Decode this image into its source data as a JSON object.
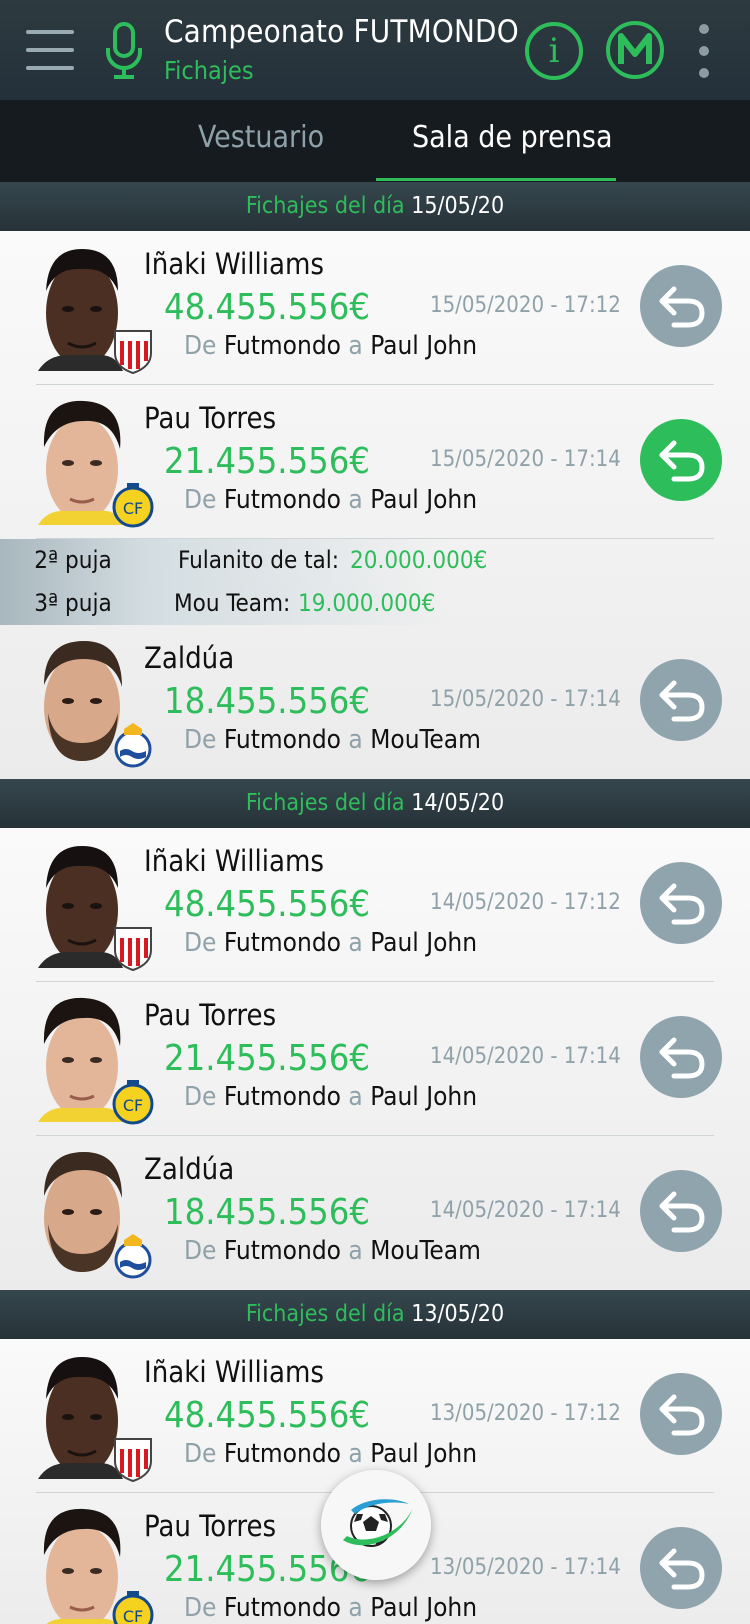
{
  "header": {
    "title": "Campeonato FUTMONDO",
    "subtitle": "Fichajes",
    "info_label": "i"
  },
  "tabs": [
    {
      "label": "Vestuario",
      "active": false
    },
    {
      "label": "Sala de prensa",
      "active": true
    }
  ],
  "colors": {
    "accent": "#2ebd5b",
    "undo": "#8fa4ad",
    "header": "#263238"
  },
  "days": [
    {
      "label": "Fichajes del día",
      "date": "15/05/20",
      "items": [
        {
          "name": "Iñaki Williams",
          "price": "48.455.556€",
          "when": "15/05/2020 - 17:12",
          "de": "De",
          "from": "Futmondo",
          "a": "a",
          "to": "Paul John",
          "club": "athletic-badge",
          "undo_active": false
        },
        {
          "name": "Pau Torres",
          "price": "21.455.556€",
          "when": "15/05/2020 - 17:14",
          "de": "De",
          "from": "Futmondo",
          "a": "a",
          "to": "Paul John",
          "club": "villarreal-badge",
          "undo_active": true,
          "bids": [
            {
              "rank": "2ª puja",
              "bidder": "Fulanito de tal:",
              "amount": "20.000.000€"
            },
            {
              "rank": "3ª puja",
              "bidder": "Mou Team:",
              "amount": "19.000.000€"
            }
          ]
        },
        {
          "name": "Zaldúa",
          "price": "18.455.556€",
          "when": "15/05/2020 - 17:14",
          "de": "De",
          "from": "Futmondo",
          "a": "a",
          "to": "MouTeam",
          "club": "real-sociedad-badge",
          "undo_active": false
        }
      ]
    },
    {
      "label": "Fichajes del día",
      "date": "14/05/20",
      "items": [
        {
          "name": "Iñaki Williams",
          "price": "48.455.556€",
          "when": "14/05/2020 - 17:12",
          "de": "De",
          "from": "Futmondo",
          "a": "a",
          "to": "Paul John",
          "club": "athletic-badge",
          "undo_active": false
        },
        {
          "name": "Pau Torres",
          "price": "21.455.556€",
          "when": "14/05/2020 - 17:14",
          "de": "De",
          "from": "Futmondo",
          "a": "a",
          "to": "Paul John",
          "club": "villarreal-badge",
          "undo_active": false
        },
        {
          "name": "Zaldúa",
          "price": "18.455.556€",
          "when": "14/05/2020 - 17:14",
          "de": "De",
          "from": "Futmondo",
          "a": "a",
          "to": "MouTeam",
          "club": "real-sociedad-badge",
          "undo_active": false
        }
      ]
    },
    {
      "label": "Fichajes del día",
      "date": "13/05/20",
      "items": [
        {
          "name": "Iñaki Williams",
          "price": "48.455.556€",
          "when": "13/05/2020 - 17:12",
          "de": "De",
          "from": "Futmondo",
          "a": "a",
          "to": "Paul John",
          "club": "athletic-badge",
          "undo_active": false
        },
        {
          "name": "Pau Torres",
          "price": "21.455.556€",
          "when": "13/05/2020 - 17:14",
          "de": "De",
          "from": "Futmondo",
          "a": "a",
          "to": "Paul John",
          "club": "villarreal-badge",
          "undo_active": false
        }
      ]
    }
  ]
}
